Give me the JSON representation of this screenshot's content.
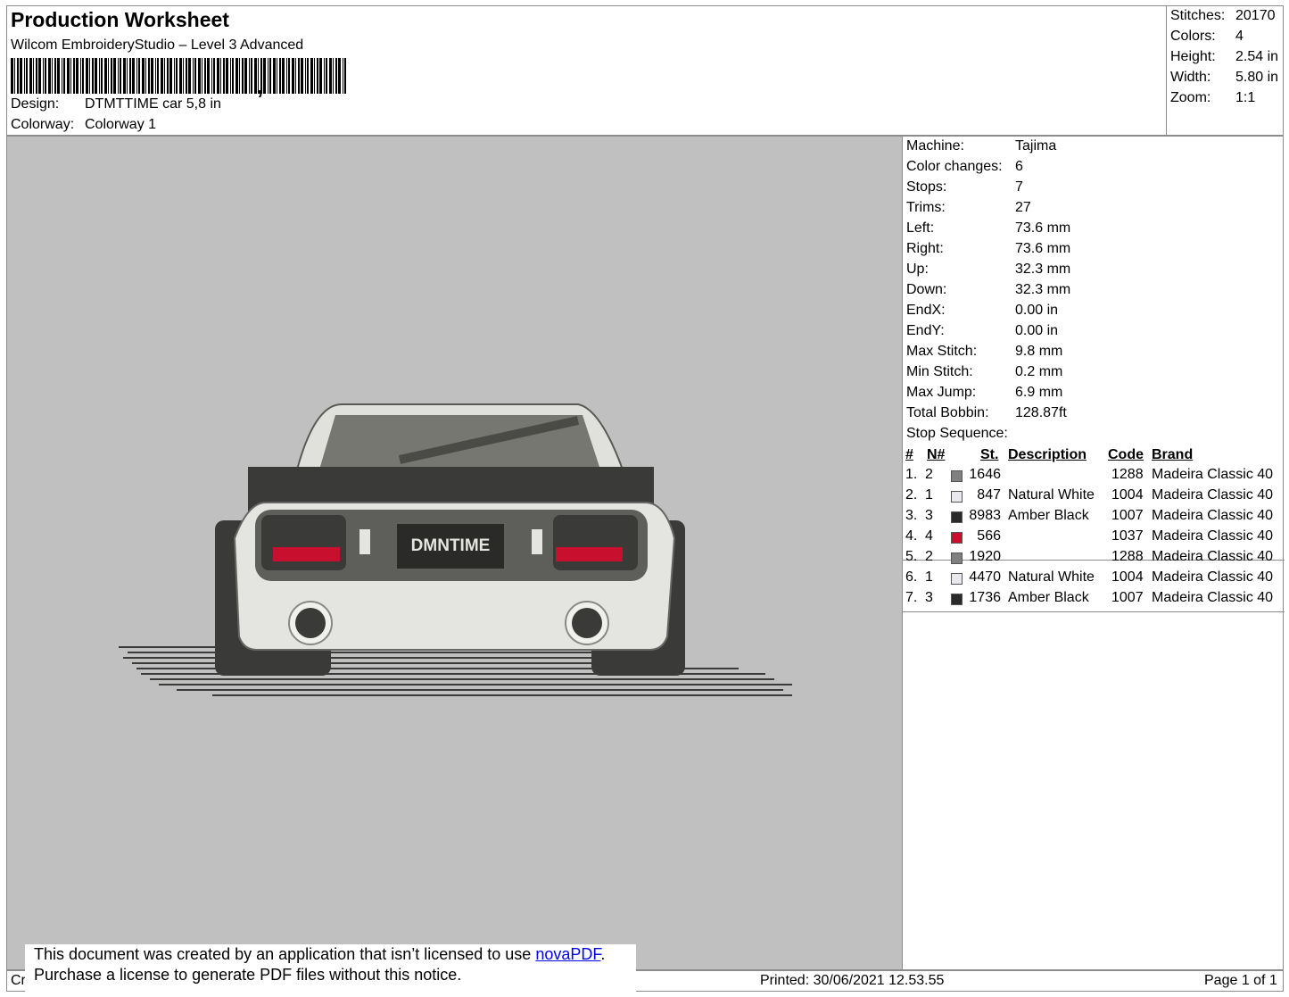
{
  "header": {
    "title": "Production Worksheet",
    "subtitle": "Wilcom EmbroideryStudio – Level 3 Advanced",
    "barcode_comma": ",",
    "design_label": "Design:",
    "design_value": "DTMTTIME car 5,8 in",
    "colorway_label": "Colorway:",
    "colorway_value": "Colorway 1"
  },
  "summary": {
    "stitches_label": "Stitches:",
    "stitches_value": "20170",
    "colors_label": "Colors:",
    "colors_value": "4",
    "height_label": "Height:",
    "height_value": "2.54 in",
    "width_label": "Width:",
    "width_value": "5.80 in",
    "zoom_label": "Zoom:",
    "zoom_value": "1:1"
  },
  "preview": {
    "plate_text": "DMNTIME",
    "background_color": "#c0c0c0"
  },
  "machine_info": [
    {
      "label": "Machine:",
      "value": "Tajima"
    },
    {
      "label": "Color changes:",
      "value": "6"
    },
    {
      "label": "Stops:",
      "value": "7"
    },
    {
      "label": "Trims:",
      "value": "27"
    },
    {
      "label": "Left:",
      "value": "73.6 mm"
    },
    {
      "label": "Right:",
      "value": "73.6 mm"
    },
    {
      "label": "Up:",
      "value": "32.3 mm"
    },
    {
      "label": "Down:",
      "value": "32.3 mm"
    },
    {
      "label": "EndX:",
      "value": "0.00 in"
    },
    {
      "label": "EndY:",
      "value": "0.00 in"
    },
    {
      "label": "Max Stitch:",
      "value": "9.8 mm"
    },
    {
      "label": "Min Stitch:",
      "value": "0.2 mm"
    },
    {
      "label": "Max Jump:",
      "value": "6.9 mm"
    },
    {
      "label": "Total Bobbin:",
      "value": "128.87ft"
    }
  ],
  "stop_sequence": {
    "label": "Stop Sequence:",
    "columns": {
      "num": "#",
      "needle": "N#",
      "stitches": "St.",
      "description": "Description",
      "code": "Code",
      "brand": "Brand"
    },
    "rows": [
      {
        "num": "1.",
        "needle": "2",
        "color": "#808080",
        "stitches": "1646",
        "description": "",
        "code": "1288",
        "brand": "Madeira Classic 40"
      },
      {
        "num": "2.",
        "needle": "1",
        "color": "#e8e8ee",
        "stitches": "847",
        "description": "Natural White",
        "code": "1004",
        "brand": "Madeira Classic 40"
      },
      {
        "num": "3.",
        "needle": "3",
        "color": "#2a2a2a",
        "stitches": "8983",
        "description": "Amber Black",
        "code": "1007",
        "brand": "Madeira Classic 40"
      },
      {
        "num": "4.",
        "needle": "4",
        "color": "#c8102e",
        "stitches": "566",
        "description": "",
        "code": "1037",
        "brand": "Madeira Classic 40"
      },
      {
        "num": "5.",
        "needle": "2",
        "color": "#808080",
        "stitches": "1920",
        "description": "",
        "code": "1288",
        "brand": "Madeira Classic 40"
      },
      {
        "num": "6.",
        "needle": "1",
        "color": "#e8e8ee",
        "stitches": "4470",
        "description": "Natural White",
        "code": "1004",
        "brand": "Madeira Classic 40"
      },
      {
        "num": "7.",
        "needle": "3",
        "color": "#2a2a2a",
        "stitches": "1736",
        "description": "Amber Black",
        "code": "1007",
        "brand": "Madeira Classic 40"
      }
    ]
  },
  "footer": {
    "left_text": "Cr",
    "printed": "Printed: 30/06/2021 12.53.55",
    "page": "Page 1 of 1"
  },
  "notice": {
    "line1_before": "This document was created by an application that isn’t licensed to use ",
    "link": "novaPDF",
    "line1_after": ".",
    "line2": "Purchase a license to generate PDF files without this notice."
  }
}
